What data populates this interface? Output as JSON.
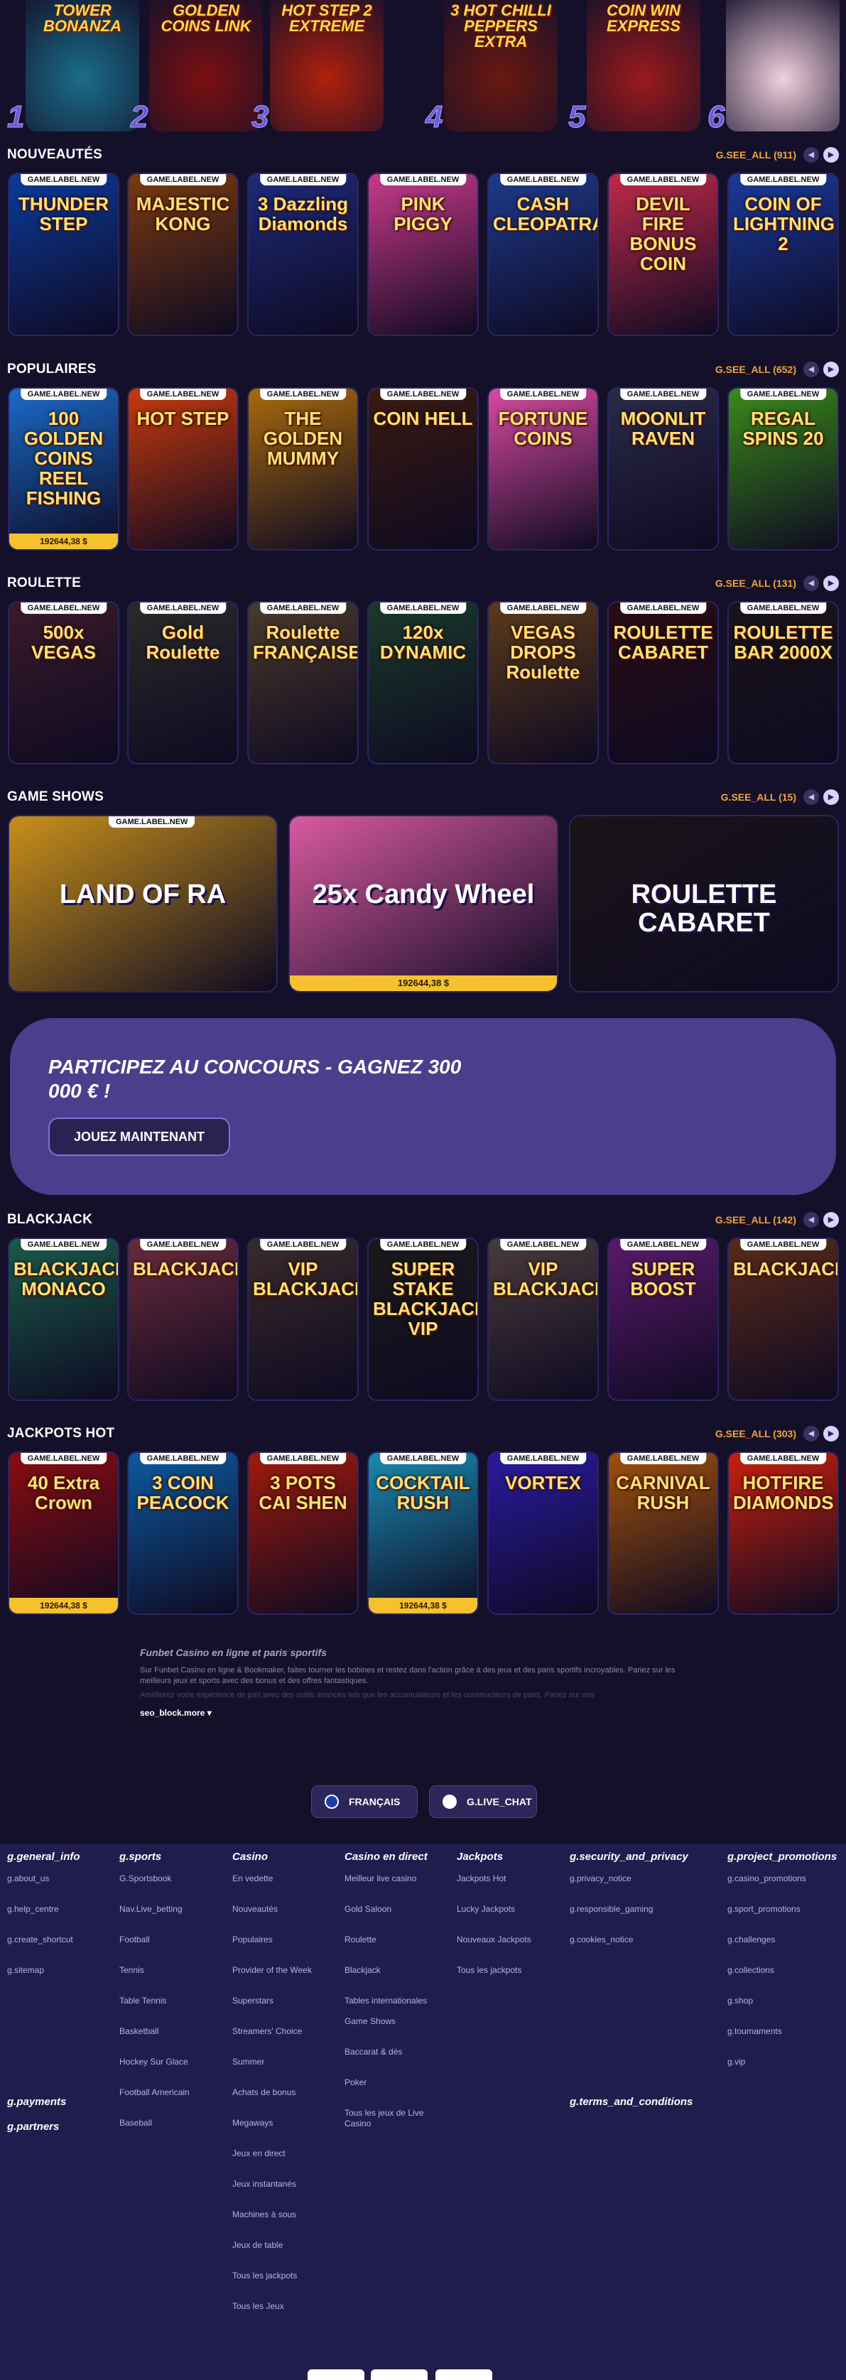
{
  "top_games": [
    {
      "title": "TOWER BONANZA",
      "rank": "1",
      "bg": "#1a6d8a"
    },
    {
      "title": "GOLDEN COINS LINK",
      "rank": "2",
      "bg": "#7a1010"
    },
    {
      "title": "HOT STEP 2 EXTREME",
      "rank": "3",
      "bg": "#b0200c"
    },
    {
      "title": "3 HOT CHILLI PEPPERS EXTRA",
      "rank": "4",
      "bg": "#6a1810"
    },
    {
      "title": "COIN WIN EXPRESS",
      "rank": "5",
      "bg": "#9a1a1a"
    },
    {
      "title": "",
      "rank": "6",
      "bg": "#f2d0dd"
    }
  ],
  "sections": [
    {
      "title": "NOUVEAUTÉS",
      "see_all": "G.SEE_ALL (911)",
      "badge": "GAME.LABEL.NEW",
      "games": [
        {
          "name": "THUNDER STEP",
          "bg": "#0c3a9a",
          "jackpot": ""
        },
        {
          "name": "MAJESTIC KONG",
          "bg": "#7a3a10",
          "jackpot": ""
        },
        {
          "name": "3 Dazzling Diamonds",
          "bg": "#1e2a7a",
          "jackpot": ""
        },
        {
          "name": "PINK PIGGY",
          "bg": "#c83a8a",
          "jackpot": ""
        },
        {
          "name": "CASH CLEOPATRA",
          "bg": "#1e3a8a",
          "jackpot": ""
        },
        {
          "name": "DEVIL FIRE BONUS COIN",
          "bg": "#c02a4a",
          "jackpot": ""
        },
        {
          "name": "COIN OF LIGHTNING 2",
          "bg": "#1a3a9a",
          "jackpot": ""
        }
      ]
    },
    {
      "title": "POPULAIRES",
      "see_all": "G.SEE_ALL (652)",
      "badge": "GAME.LABEL.NEW",
      "games": [
        {
          "name": "100 GOLDEN COINS REEL FISHING",
          "bg": "#1a6ac8",
          "jackpot": "192644,38 $"
        },
        {
          "name": "HOT STEP",
          "bg": "#c83a0c",
          "jackpot": ""
        },
        {
          "name": "THE GOLDEN MUMMY",
          "bg": "#a86a0c",
          "jackpot": ""
        },
        {
          "name": "COIN HELL",
          "bg": "#3a1a10",
          "jackpot": ""
        },
        {
          "name": "FORTUNE COINS",
          "bg": "#d84aa0",
          "jackpot": ""
        },
        {
          "name": "MOONLIT RAVEN",
          "bg": "#2a2a4a",
          "jackpot": ""
        },
        {
          "name": "REGAL SPINS 20",
          "bg": "#3a8a1a",
          "jackpot": ""
        }
      ]
    },
    {
      "title": "ROULETTE",
      "see_all": "G.SEE_ALL (131)",
      "badge": "GAME.LABEL.NEW",
      "games": [
        {
          "name": "500x VEGAS",
          "bg": "#3a1a2a",
          "jackpot": ""
        },
        {
          "name": "Gold Roulette",
          "bg": "#2a2a2a",
          "jackpot": ""
        },
        {
          "name": "Roulette FRANÇAISE",
          "bg": "#4a3a2a",
          "jackpot": ""
        },
        {
          "name": "120x DYNAMIC",
          "bg": "#1a3a2a",
          "jackpot": ""
        },
        {
          "name": "VEGAS DROPS Roulette",
          "bg": "#5a3a1a",
          "jackpot": ""
        },
        {
          "name": "ROULETTE CABARET",
          "bg": "#2a0c14",
          "jackpot": ""
        },
        {
          "name": "ROULETTE BAR 2000X",
          "bg": "#1a1418",
          "jackpot": ""
        }
      ]
    },
    {
      "title": "BLACKJACK",
      "see_all": "G.SEE_ALL (142)",
      "badge": "GAME.LABEL.NEW",
      "games": [
        {
          "name": "BLACKJACK MONACO",
          "bg": "#1a5a4a",
          "jackpot": ""
        },
        {
          "name": "BLACKJACK",
          "bg": "#6a2a3a",
          "jackpot": ""
        },
        {
          "name": "VIP BLACKJACK",
          "bg": "#3a2a2a",
          "jackpot": ""
        },
        {
          "name": "SUPER STAKE BLACKJACK VIP",
          "bg": "#1a1a1a",
          "jackpot": ""
        },
        {
          "name": "VIP BLACKJACK",
          "bg": "#4a3a3a",
          "jackpot": ""
        },
        {
          "name": "SUPER BOOST",
          "bg": "#5a1a6a",
          "jackpot": ""
        },
        {
          "name": "BLACKJACK",
          "bg": "#5a2a1a",
          "jackpot": ""
        }
      ]
    },
    {
      "title": "JACKPOTS HOT",
      "see_all": "G.SEE_ALL (303)",
      "badge": "GAME.LABEL.NEW",
      "games": [
        {
          "name": "40 Extra Crown",
          "bg": "#8a0c10",
          "jackpot": "192644,38 $"
        },
        {
          "name": "3 COIN PEACOCK",
          "bg": "#0c5aa0",
          "jackpot": ""
        },
        {
          "name": "3 POTS CAI SHEN",
          "bg": "#a01a0c",
          "jackpot": ""
        },
        {
          "name": "COCKTAIL RUSH",
          "bg": "#1a8ab0",
          "jackpot": "192644,38 $"
        },
        {
          "name": "VORTEX",
          "bg": "#2a1aa0",
          "jackpot": ""
        },
        {
          "name": "CARNIVAL RUSH",
          "bg": "#a0500c",
          "jackpot": ""
        },
        {
          "name": "HOTFIRE DIAMONDS",
          "bg": "#c8200c",
          "jackpot": ""
        }
      ]
    }
  ],
  "game_shows": {
    "title": "GAME SHOWS",
    "see_all": "G.SEE_ALL (15)",
    "badge": "GAME.LABEL.NEW",
    "games": [
      {
        "name": "LAND OF RA",
        "bg": "#c8901a",
        "jackpot": ""
      },
      {
        "name": "25x Candy Wheel",
        "bg": "#d85aa0",
        "jackpot": "192644,38 $"
      },
      {
        "name": "ROULETTE CABARET",
        "bg": "#1a1418",
        "jackpot": ""
      }
    ]
  },
  "promo": {
    "title": "PARTICIPEZ AU CONCOURS - GAGNEZ 300 000 € !",
    "button": "JOUEZ MAINTENANT"
  },
  "seo": {
    "title": "Funbet Casino en ligne et paris sportifs",
    "text": "Sur Funbet Casino en ligne & Bookmaker, faites tourner les bobines et restez dans l'action grâce à des jeux et des paris sportifs incroyables. Pariez sur les meilleurs jeux et sports avec des bonus et des offres fantastiques.",
    "fade": "Améliorez votre expérience de pari avec des outils avancés tels que les accumulateurs et les constructeurs de paris. Pariez sur vos",
    "more": "seo_block.more ▾"
  },
  "language": {
    "lang": "FRANÇAIS",
    "chat": "G.LIVE_CHAT"
  },
  "footer": {
    "columns": [
      {
        "title": "g.general_info",
        "links": [
          "g.about_us",
          "g.help_centre",
          "g.create_shortcut",
          "g.sitemap"
        ]
      },
      {
        "title": "g.sports",
        "links": [
          "G.Sportsbook",
          "Nav.Live_betting",
          "Football",
          "Tennis",
          "Table Tennis",
          "Basketball",
          "Hockey Sur Glace",
          "Football Americain",
          "Baseball"
        ]
      },
      {
        "title": "Casino",
        "links": [
          "En vedette",
          "Nouveautés",
          "Populaires",
          "Provider of the Week",
          "Superstars",
          "Streamers' Choice",
          "Summer",
          "Achats de bonus",
          "Megaways",
          "Jeux en direct",
          "Jeux instantanés",
          "Machines à sous",
          "Jeux de table",
          "Tous les jackpots",
          "Tous les Jeux"
        ]
      },
      {
        "title": "Casino en direct",
        "links": [
          "Meilleur live casino",
          "Gold Saloon",
          "Roulette",
          "Blackjack",
          "Tables internationales",
          "Game Shows",
          "Baccarat & dés",
          "Poker",
          "Tous les jeux de Live Casino"
        ]
      },
      {
        "title": "Jackpots",
        "links": [
          "Jackpots Hot",
          "Lucky Jackpots",
          "Nouveaux Jackpots",
          "Tous les jackpots"
        ]
      },
      {
        "title": "g.security_and_privacy",
        "links": [
          "g.privacy_notice",
          "g.responsible_gaming",
          "g.cookies_notice"
        ]
      },
      {
        "title": "g.project_promotions",
        "links": [
          "g.casino_promotions",
          "g.sport_promotions",
          "g.challenges",
          "g.collections",
          "g.shop",
          "g.tournaments",
          "g.vip"
        ]
      }
    ],
    "payments": "g.payments",
    "partners": "g.partners",
    "terms": "g.terms_and_conditions"
  }
}
